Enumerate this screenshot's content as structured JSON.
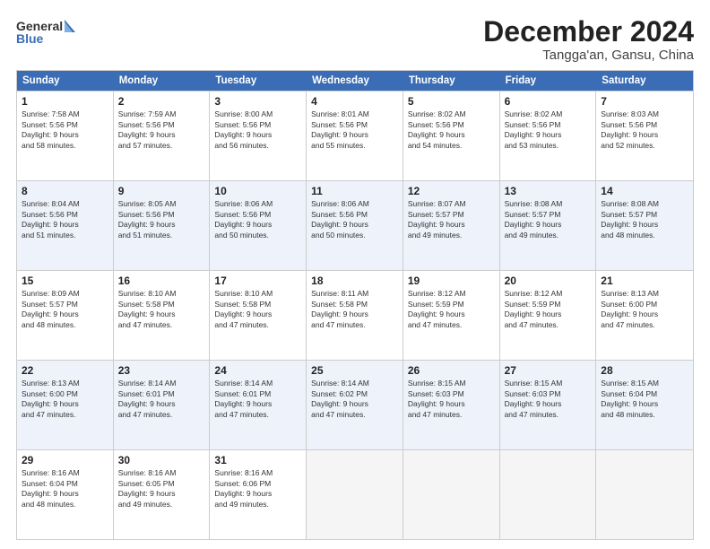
{
  "logo": {
    "line1": "General",
    "line2": "Blue"
  },
  "title": "December 2024",
  "subtitle": "Tangga'an, Gansu, China",
  "days": [
    "Sunday",
    "Monday",
    "Tuesday",
    "Wednesday",
    "Thursday",
    "Friday",
    "Saturday"
  ],
  "rows": [
    [
      {
        "day": "1",
        "lines": [
          "Sunrise: 7:58 AM",
          "Sunset: 5:56 PM",
          "Daylight: 9 hours",
          "and 58 minutes."
        ]
      },
      {
        "day": "2",
        "lines": [
          "Sunrise: 7:59 AM",
          "Sunset: 5:56 PM",
          "Daylight: 9 hours",
          "and 57 minutes."
        ]
      },
      {
        "day": "3",
        "lines": [
          "Sunrise: 8:00 AM",
          "Sunset: 5:56 PM",
          "Daylight: 9 hours",
          "and 56 minutes."
        ]
      },
      {
        "day": "4",
        "lines": [
          "Sunrise: 8:01 AM",
          "Sunset: 5:56 PM",
          "Daylight: 9 hours",
          "and 55 minutes."
        ]
      },
      {
        "day": "5",
        "lines": [
          "Sunrise: 8:02 AM",
          "Sunset: 5:56 PM",
          "Daylight: 9 hours",
          "and 54 minutes."
        ]
      },
      {
        "day": "6",
        "lines": [
          "Sunrise: 8:02 AM",
          "Sunset: 5:56 PM",
          "Daylight: 9 hours",
          "and 53 minutes."
        ]
      },
      {
        "day": "7",
        "lines": [
          "Sunrise: 8:03 AM",
          "Sunset: 5:56 PM",
          "Daylight: 9 hours",
          "and 52 minutes."
        ]
      }
    ],
    [
      {
        "day": "8",
        "lines": [
          "Sunrise: 8:04 AM",
          "Sunset: 5:56 PM",
          "Daylight: 9 hours",
          "and 51 minutes."
        ]
      },
      {
        "day": "9",
        "lines": [
          "Sunrise: 8:05 AM",
          "Sunset: 5:56 PM",
          "Daylight: 9 hours",
          "and 51 minutes."
        ]
      },
      {
        "day": "10",
        "lines": [
          "Sunrise: 8:06 AM",
          "Sunset: 5:56 PM",
          "Daylight: 9 hours",
          "and 50 minutes."
        ]
      },
      {
        "day": "11",
        "lines": [
          "Sunrise: 8:06 AM",
          "Sunset: 5:56 PM",
          "Daylight: 9 hours",
          "and 50 minutes."
        ]
      },
      {
        "day": "12",
        "lines": [
          "Sunrise: 8:07 AM",
          "Sunset: 5:57 PM",
          "Daylight: 9 hours",
          "and 49 minutes."
        ]
      },
      {
        "day": "13",
        "lines": [
          "Sunrise: 8:08 AM",
          "Sunset: 5:57 PM",
          "Daylight: 9 hours",
          "and 49 minutes."
        ]
      },
      {
        "day": "14",
        "lines": [
          "Sunrise: 8:08 AM",
          "Sunset: 5:57 PM",
          "Daylight: 9 hours",
          "and 48 minutes."
        ]
      }
    ],
    [
      {
        "day": "15",
        "lines": [
          "Sunrise: 8:09 AM",
          "Sunset: 5:57 PM",
          "Daylight: 9 hours",
          "and 48 minutes."
        ]
      },
      {
        "day": "16",
        "lines": [
          "Sunrise: 8:10 AM",
          "Sunset: 5:58 PM",
          "Daylight: 9 hours",
          "and 47 minutes."
        ]
      },
      {
        "day": "17",
        "lines": [
          "Sunrise: 8:10 AM",
          "Sunset: 5:58 PM",
          "Daylight: 9 hours",
          "and 47 minutes."
        ]
      },
      {
        "day": "18",
        "lines": [
          "Sunrise: 8:11 AM",
          "Sunset: 5:58 PM",
          "Daylight: 9 hours",
          "and 47 minutes."
        ]
      },
      {
        "day": "19",
        "lines": [
          "Sunrise: 8:12 AM",
          "Sunset: 5:59 PM",
          "Daylight: 9 hours",
          "and 47 minutes."
        ]
      },
      {
        "day": "20",
        "lines": [
          "Sunrise: 8:12 AM",
          "Sunset: 5:59 PM",
          "Daylight: 9 hours",
          "and 47 minutes."
        ]
      },
      {
        "day": "21",
        "lines": [
          "Sunrise: 8:13 AM",
          "Sunset: 6:00 PM",
          "Daylight: 9 hours",
          "and 47 minutes."
        ]
      }
    ],
    [
      {
        "day": "22",
        "lines": [
          "Sunrise: 8:13 AM",
          "Sunset: 6:00 PM",
          "Daylight: 9 hours",
          "and 47 minutes."
        ]
      },
      {
        "day": "23",
        "lines": [
          "Sunrise: 8:14 AM",
          "Sunset: 6:01 PM",
          "Daylight: 9 hours",
          "and 47 minutes."
        ]
      },
      {
        "day": "24",
        "lines": [
          "Sunrise: 8:14 AM",
          "Sunset: 6:01 PM",
          "Daylight: 9 hours",
          "and 47 minutes."
        ]
      },
      {
        "day": "25",
        "lines": [
          "Sunrise: 8:14 AM",
          "Sunset: 6:02 PM",
          "Daylight: 9 hours",
          "and 47 minutes."
        ]
      },
      {
        "day": "26",
        "lines": [
          "Sunrise: 8:15 AM",
          "Sunset: 6:03 PM",
          "Daylight: 9 hours",
          "and 47 minutes."
        ]
      },
      {
        "day": "27",
        "lines": [
          "Sunrise: 8:15 AM",
          "Sunset: 6:03 PM",
          "Daylight: 9 hours",
          "and 47 minutes."
        ]
      },
      {
        "day": "28",
        "lines": [
          "Sunrise: 8:15 AM",
          "Sunset: 6:04 PM",
          "Daylight: 9 hours",
          "and 48 minutes."
        ]
      }
    ],
    [
      {
        "day": "29",
        "lines": [
          "Sunrise: 8:16 AM",
          "Sunset: 6:04 PM",
          "Daylight: 9 hours",
          "and 48 minutes."
        ]
      },
      {
        "day": "30",
        "lines": [
          "Sunrise: 8:16 AM",
          "Sunset: 6:05 PM",
          "Daylight: 9 hours",
          "and 49 minutes."
        ]
      },
      {
        "day": "31",
        "lines": [
          "Sunrise: 8:16 AM",
          "Sunset: 6:06 PM",
          "Daylight: 9 hours",
          "and 49 minutes."
        ]
      },
      null,
      null,
      null,
      null
    ]
  ]
}
